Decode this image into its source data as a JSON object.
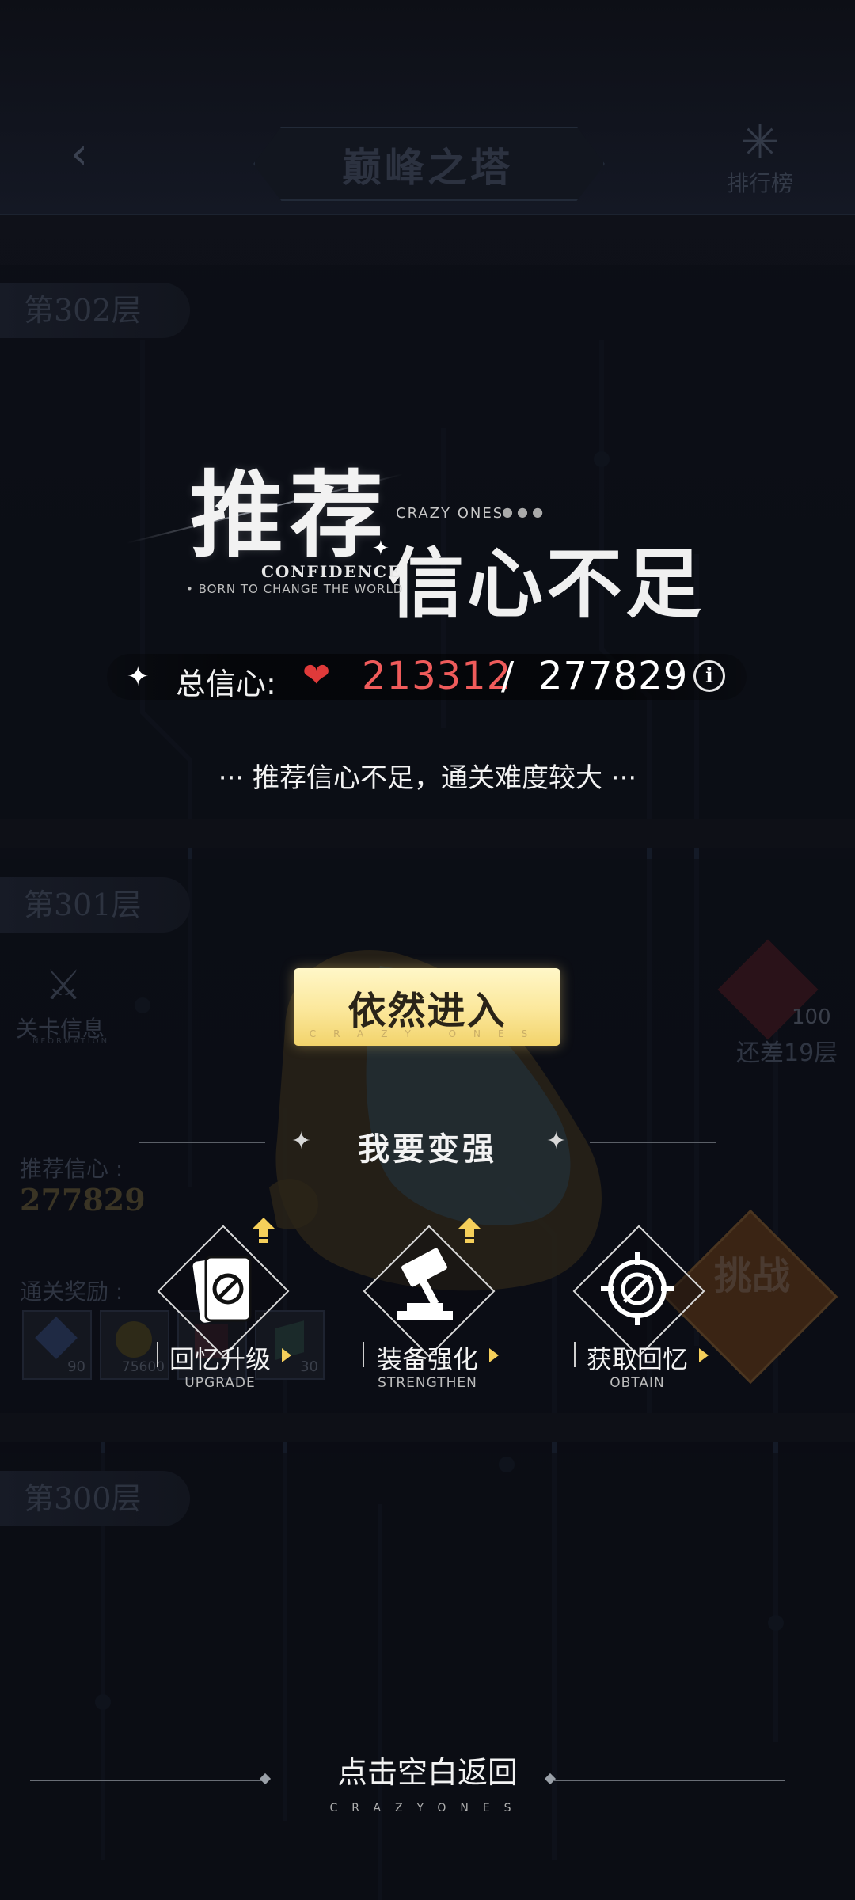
{
  "top_bar": {
    "title": "巅峰之塔",
    "ranking_label": "排行榜"
  },
  "floors": [
    {
      "label": "第302层"
    },
    {
      "label": "第301层"
    },
    {
      "label": "第300层"
    }
  ],
  "floor_301": {
    "stage_info_label": "关卡信息",
    "stage_info_sub": "INFORMATION",
    "recommended_label": "推荐信心 :",
    "recommended_value": "277829",
    "rewards_label": "通关奖励 :",
    "rewards": [
      "90",
      "75600",
      "30"
    ],
    "gap_text": "还差19层",
    "gap_count": "100",
    "challenge_label": "挑战"
  },
  "popup": {
    "headline_big": "推荐",
    "headline_main": "信心不足",
    "crazy_ones": "CRAZY ONES",
    "confidence": "CONFIDENCE",
    "born": "• BORN TO CHANGE THE WORLD",
    "total_label": "总信心:",
    "current": "213312",
    "slash": "/",
    "required": "277829",
    "hint": "··· 推荐信心不足，通关难度较大 ···",
    "enter_label": "依然进入",
    "enter_sub": "CRAZY ONES",
    "strong_title": "我要变强",
    "options": [
      {
        "label": "回忆升级",
        "sub": "UPGRADE",
        "icon": "card-upgrade-icon"
      },
      {
        "label": "装备强化",
        "sub": "STRENGTHEN",
        "icon": "hammer-icon"
      },
      {
        "label": "获取回忆",
        "sub": "OBTAIN",
        "icon": "target-icon"
      }
    ],
    "back_hint": "点击空白返回",
    "back_sub": "CRAZYONES"
  },
  "colors": {
    "accent_gold": "#f5cf5a",
    "heart_red": "#e03a3a",
    "current_red": "#ef5b5b",
    "button_yellow": "#fbe79a"
  }
}
